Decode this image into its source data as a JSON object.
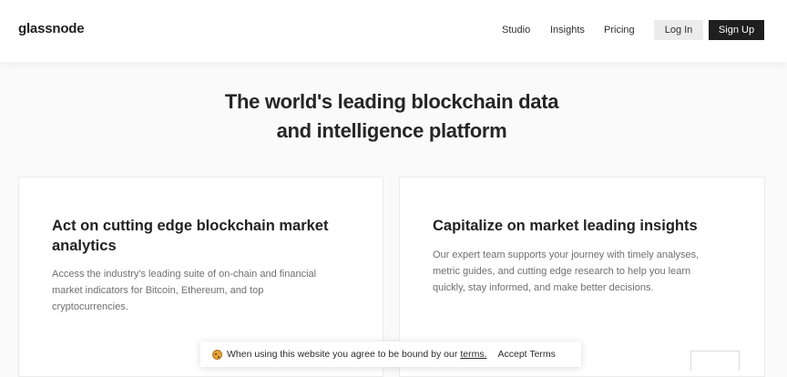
{
  "header": {
    "logo": "glassnode",
    "nav": [
      "Studio",
      "Insights",
      "Pricing"
    ],
    "login_label": "Log In",
    "signup_label": "Sign Up"
  },
  "hero": {
    "title_line1": "The world's leading blockchain data",
    "title_line2": "and intelligence platform"
  },
  "cards": [
    {
      "heading_line1": "Act on cutting edge blockchain market",
      "heading_line2": "analytics",
      "body_lines": [
        "Access the industry's leading suite of on-chain and financial",
        "market indicators for Bitcoin, Ethereum, and top",
        "cryptocurrencies."
      ]
    },
    {
      "heading_line1": "Capitalize on market leading insights",
      "body_lines": [
        "Our expert team supports your journey with timely analyses,",
        "metric guides, and cutting edge research to help you learn",
        "quickly, stay informed, and make better decisions."
      ]
    }
  ],
  "cookie": {
    "icon": "cookie-icon",
    "text": "When using this website you agree to be bound by our",
    "terms_label": "terms.",
    "accept_label": "Accept Terms"
  }
}
